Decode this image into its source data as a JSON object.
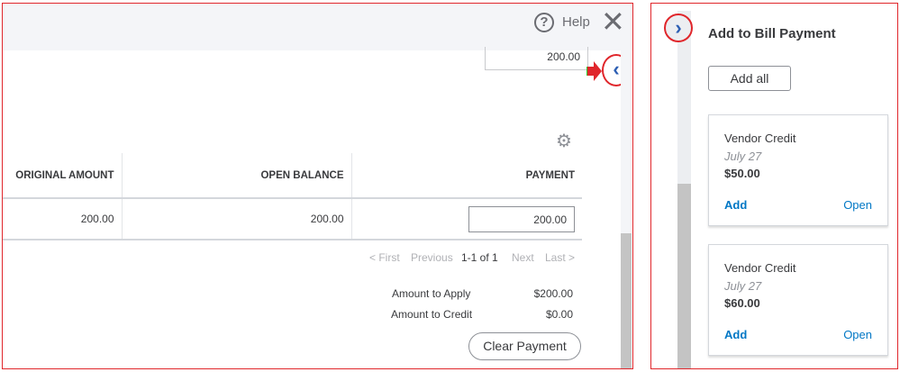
{
  "header": {
    "help_icon_glyph": "?",
    "help_label": "Help",
    "close_glyph": "✕"
  },
  "top_input_value": "200.00",
  "collapse_glyph": "‹",
  "table": {
    "columns": [
      "ORIGINAL AMOUNT",
      "OPEN BALANCE",
      "PAYMENT"
    ],
    "rows": [
      {
        "original": "200.00",
        "open": "200.00",
        "payment": "200.00"
      }
    ]
  },
  "pager": {
    "first": "< First",
    "previous": "Previous",
    "range": "1-1 of 1",
    "next": "Next",
    "last": "Last >"
  },
  "summary": {
    "apply_label": "Amount to Apply",
    "apply_value": "$200.00",
    "credit_label": "Amount to Credit",
    "credit_value": "$0.00"
  },
  "clear_payment": "Clear Payment",
  "panel": {
    "expand_glyph": "›",
    "title": "Add to Bill Payment",
    "add_all": "Add all",
    "cards": [
      {
        "title": "Vendor Credit",
        "date": "July 27",
        "amount": "$50.00",
        "add": "Add",
        "open": "Open"
      },
      {
        "title": "Vendor Credit",
        "date": "July 27",
        "amount": "$60.00",
        "add": "Add",
        "open": "Open"
      }
    ]
  },
  "colors": {
    "accent": "#0077c5",
    "annotation": "#e0262b"
  }
}
